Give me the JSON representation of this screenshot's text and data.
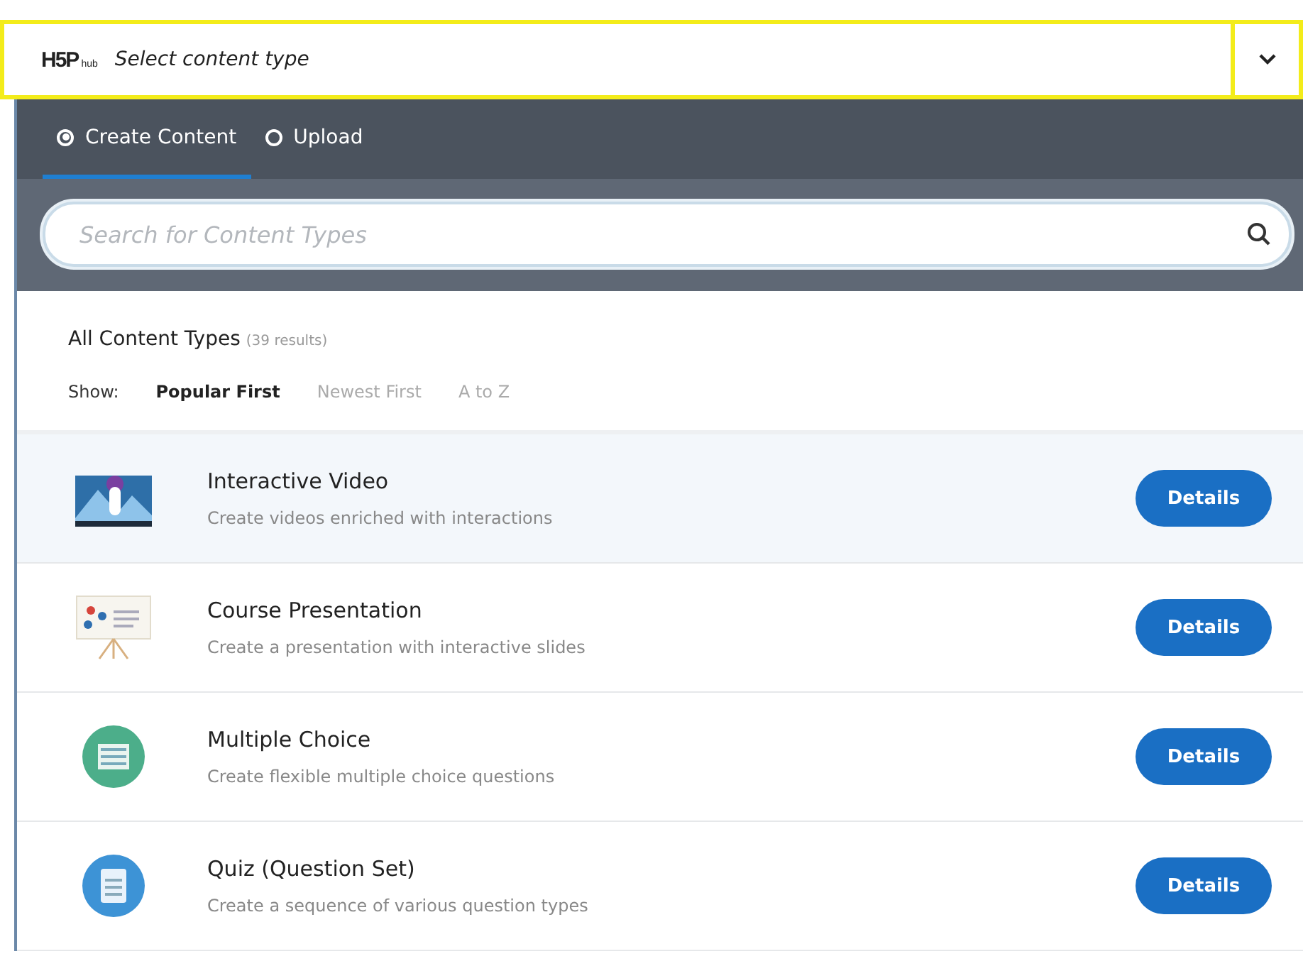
{
  "header": {
    "logo": "H5P",
    "logo_sub": "hub",
    "title": "Select content type",
    "expanded": true
  },
  "tabs": [
    {
      "label": "Create Content",
      "selected": true
    },
    {
      "label": "Upload",
      "selected": false
    }
  ],
  "search": {
    "placeholder": "Search for Content Types"
  },
  "listing": {
    "title": "All Content Types",
    "count": "(39 results)",
    "show_label": "Show:",
    "sort_options": [
      {
        "label": "Popular First",
        "selected": true
      },
      {
        "label": "Newest First",
        "selected": false
      },
      {
        "label": "A to Z",
        "selected": false
      }
    ]
  },
  "content_types": [
    {
      "kind": "video",
      "title": "Interactive Video",
      "description": "Create videos enriched with interactions",
      "button": "Details",
      "selected": true
    },
    {
      "kind": "presentation",
      "title": "Course Presentation",
      "description": "Create a presentation with interactive slides",
      "button": "Details",
      "selected": false
    },
    {
      "kind": "choice",
      "title": "Multiple Choice",
      "description": "Create flexible multiple choice questions",
      "button": "Details",
      "selected": false
    },
    {
      "kind": "quiz",
      "title": "Quiz (Question Set)",
      "description": "Create a sequence of various question types",
      "button": "Details",
      "selected": false
    }
  ]
}
